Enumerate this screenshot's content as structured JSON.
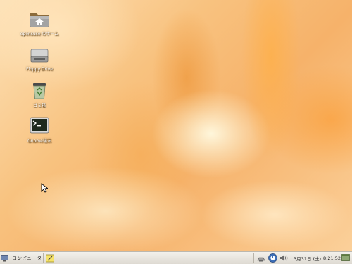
{
  "desktop": {
    "icons": [
      {
        "label": "opensuse のホーム",
        "icon": "home-folder-icon"
      },
      {
        "label": "Floppy Drive",
        "icon": "floppy-drive-icon"
      },
      {
        "label": "ゴミ箱",
        "icon": "trash-icon"
      },
      {
        "label": "Gnome端末",
        "icon": "terminal-icon"
      }
    ]
  },
  "panel": {
    "menu_label": "コンピュータ",
    "clock_date": "3月31日 (土)",
    "clock_time": "8:21:52"
  },
  "colors": {
    "wallpaper": "#f8c27f",
    "panel": "#e9e6df"
  }
}
